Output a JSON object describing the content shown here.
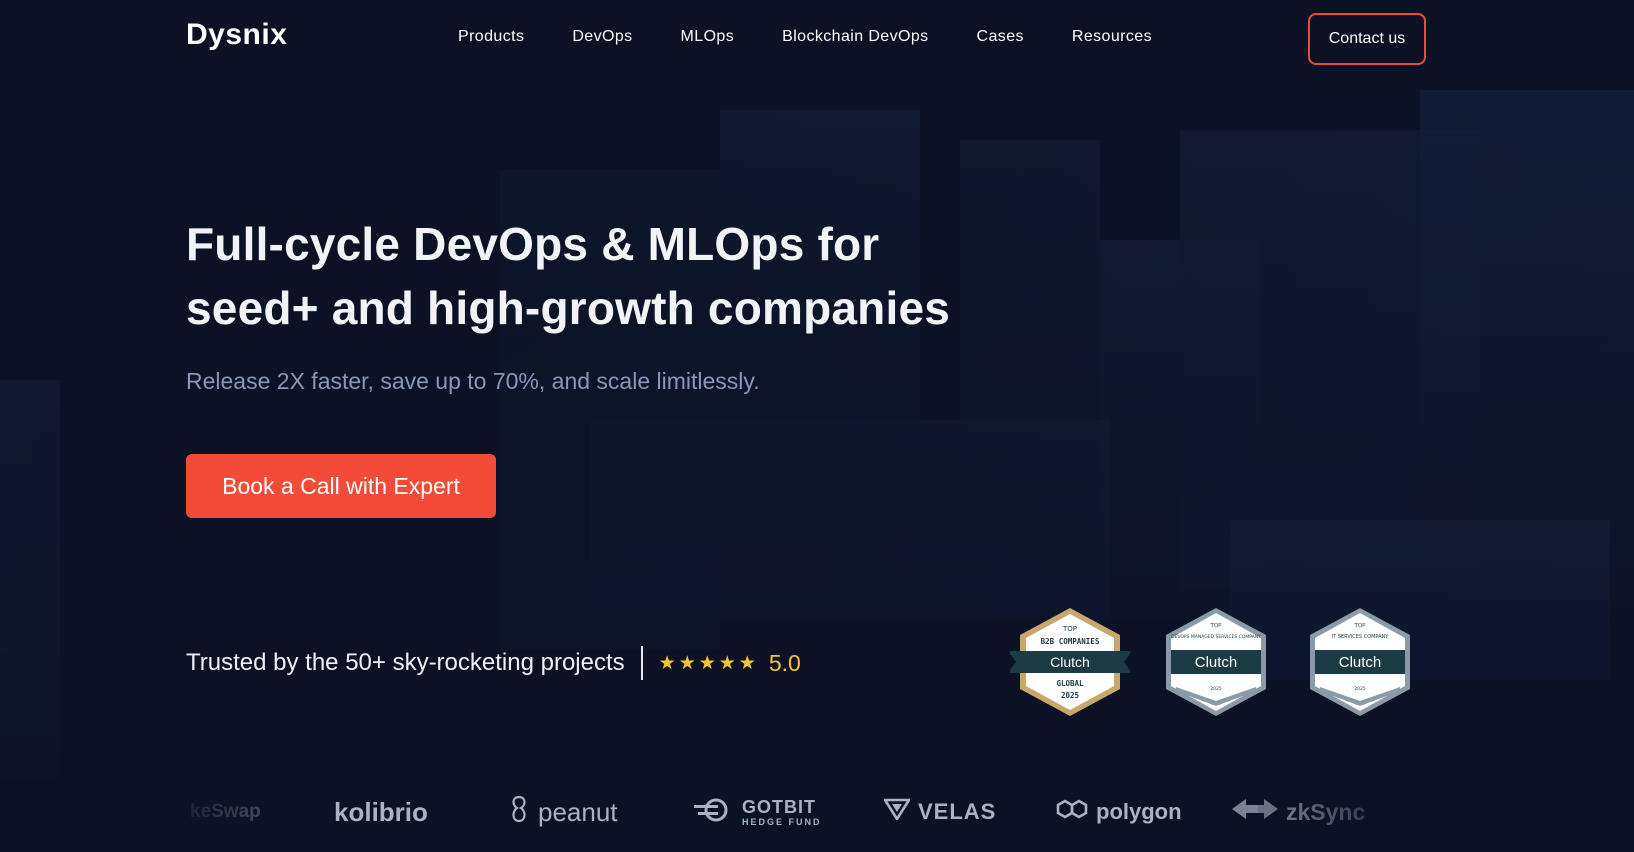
{
  "header": {
    "logo": "Dysnix",
    "nav": [
      "Products",
      "DevOps",
      "MLOps",
      "Blockchain DevOps",
      "Cases",
      "Resources"
    ],
    "contact_label": "Contact us"
  },
  "hero": {
    "title_line1": "Full-cycle DevOps & MLOps for",
    "title_line2": "seed+ and high-growth companies",
    "subtitle": "Release 2X faster, save up to 70%, and scale limitlessly.",
    "cta_label": "Book a Call with Expert"
  },
  "trust": {
    "text": "Trusted by the 50+ sky-rocketing projects",
    "stars": "★★★★★",
    "rating": "5.0"
  },
  "badges": [
    {
      "top": "TOP",
      "line": "B2B COMPANIES",
      "brand": "Clutch",
      "bottom1": "GLOBAL",
      "bottom2": "2025"
    },
    {
      "top": "TOP",
      "line": "DEVOPS MANAGED SERVICES COMPANY",
      "brand": "Clutch",
      "bottom1": "",
      "bottom2": "2025"
    },
    {
      "top": "TOP",
      "line": "IT SERVICES COMPANY",
      "brand": "Clutch",
      "bottom1": "",
      "bottom2": "2025"
    }
  ],
  "client_logos": [
    "keSwap",
    "kolibrio",
    "peanut",
    "GOTBIT",
    "HEDGE FUND",
    "VELAS",
    "polygon",
    "zkSync"
  ],
  "colors": {
    "background": "#0b1226",
    "accent": "#f24b37",
    "star": "#f7c531"
  }
}
